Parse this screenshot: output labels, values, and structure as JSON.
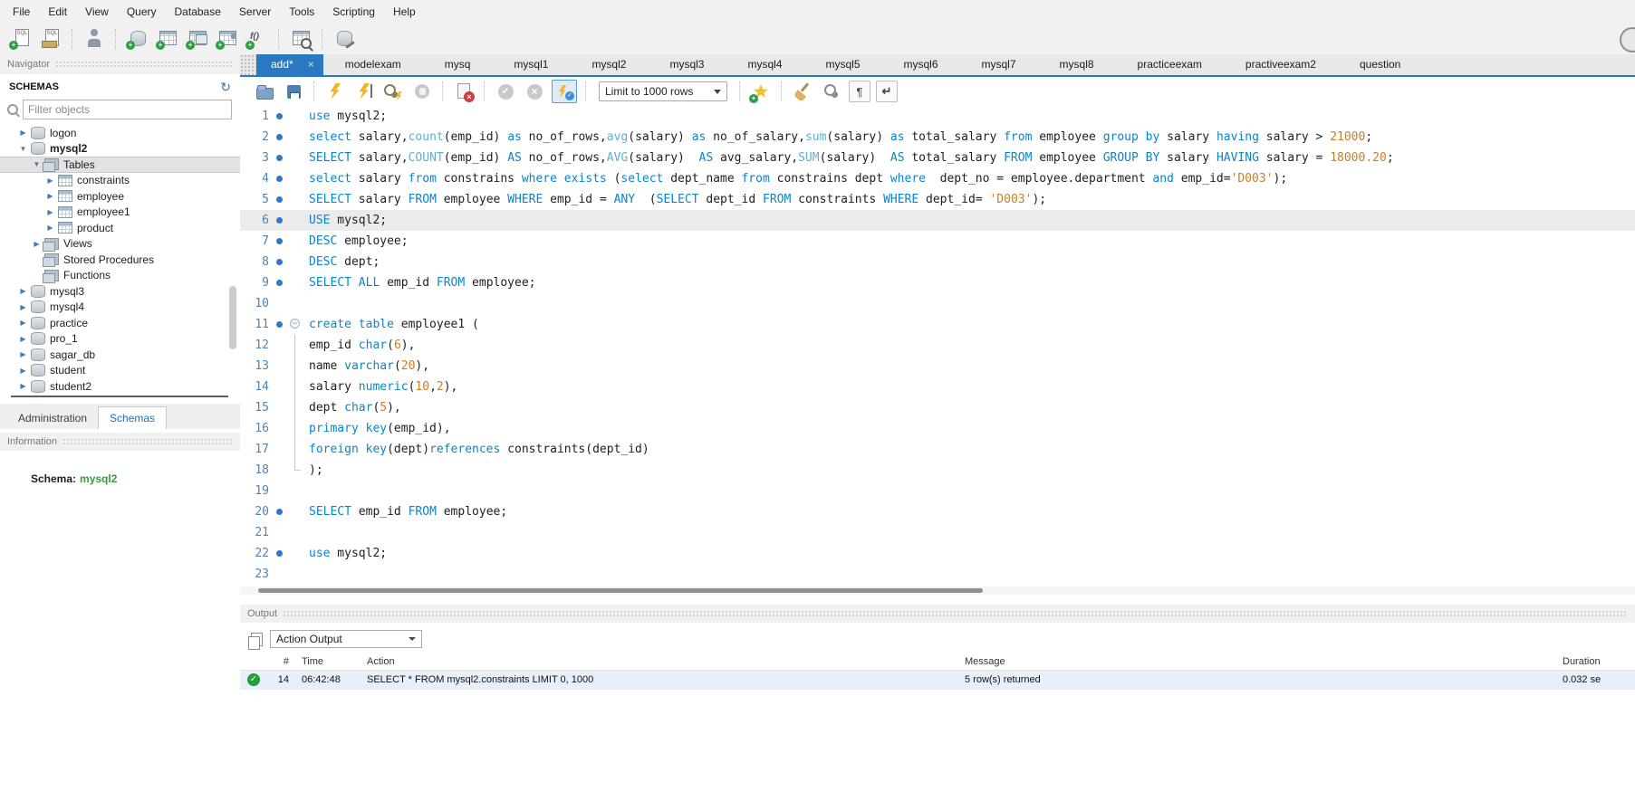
{
  "menubar": {
    "items": [
      "File",
      "Edit",
      "View",
      "Query",
      "Database",
      "Server",
      "Tools",
      "Scripting",
      "Help"
    ]
  },
  "main_toolbar": {
    "icons": [
      "new-sql-tab",
      "open-sql-script",
      "sep",
      "inspector",
      "sep",
      "create-schema",
      "create-table",
      "create-view",
      "create-procedure",
      "create-function",
      "sep",
      "search-table-data",
      "sep",
      "reconnect-dbms"
    ]
  },
  "editor_tabs": {
    "items": [
      {
        "label": "add*",
        "active": true
      },
      {
        "label": "modelexam"
      },
      {
        "label": "mysq"
      },
      {
        "label": "mysql1"
      },
      {
        "label": "mysql2"
      },
      {
        "label": "mysql3"
      },
      {
        "label": "mysql4"
      },
      {
        "label": "mysql5"
      },
      {
        "label": "mysql6"
      },
      {
        "label": "mysql7"
      },
      {
        "label": "mysql8"
      },
      {
        "label": "practiceexam"
      },
      {
        "label": "practiveexam2"
      },
      {
        "label": "question"
      }
    ]
  },
  "navigator": {
    "title": "Navigator",
    "schemas_header": "SCHEMAS",
    "filter_placeholder": "Filter objects",
    "tree": [
      {
        "ind": 1,
        "exp": "r",
        "icon": "db",
        "label": "logon"
      },
      {
        "ind": 1,
        "exp": "d",
        "icon": "db",
        "label": "mysql2",
        "bold": true
      },
      {
        "ind": 2,
        "exp": "d",
        "icon": "grp",
        "label": "Tables",
        "selected": true
      },
      {
        "ind": 3,
        "exp": "r",
        "icon": "tbl",
        "label": "constraints"
      },
      {
        "ind": 3,
        "exp": "r",
        "icon": "tbl",
        "label": "employee"
      },
      {
        "ind": 3,
        "exp": "r",
        "icon": "tbl",
        "label": "employee1"
      },
      {
        "ind": 3,
        "exp": "r",
        "icon": "tbl",
        "label": "product"
      },
      {
        "ind": 2,
        "exp": "r",
        "icon": "grp",
        "label": "Views"
      },
      {
        "ind": 2,
        "icon": "grp",
        "label": "Stored Procedures"
      },
      {
        "ind": 2,
        "icon": "grp",
        "label": "Functions"
      },
      {
        "ind": 1,
        "exp": "r",
        "icon": "db",
        "label": "mysql3"
      },
      {
        "ind": 1,
        "exp": "r",
        "icon": "db",
        "label": "mysql4"
      },
      {
        "ind": 1,
        "exp": "r",
        "icon": "db",
        "label": "practice"
      },
      {
        "ind": 1,
        "exp": "r",
        "icon": "db",
        "label": "pro_1"
      },
      {
        "ind": 1,
        "exp": "r",
        "icon": "db",
        "label": "sagar_db"
      },
      {
        "ind": 1,
        "exp": "r",
        "icon": "db",
        "label": "student"
      },
      {
        "ind": 1,
        "exp": "r",
        "icon": "db",
        "label": "student2"
      }
    ],
    "bottom_tabs": [
      {
        "label": "Administration",
        "active": false
      },
      {
        "label": "Schemas",
        "active": true
      }
    ],
    "information_title": "Information",
    "schema_label": "Schema:",
    "schema_value": "mysql2"
  },
  "editor_toolbar": {
    "icons_left": [
      "open-file",
      "save",
      "sep",
      "execute",
      "execute-current",
      "explain",
      "stop",
      "sep",
      "kill-query",
      "sep",
      "commit",
      "rollback",
      "toggle-autocommit",
      "sep"
    ],
    "limit_dropdown": "Limit to 1000 rows",
    "icons_right": [
      "sep",
      "snippet-star",
      "sep",
      "beautify",
      "find",
      "pilcrow",
      "wrap"
    ]
  },
  "editor": {
    "lines": [
      {
        "dot": true,
        "segs": [
          [
            "kw",
            "use"
          ],
          [
            "pl",
            " mysql2;"
          ]
        ]
      },
      {
        "dot": true,
        "segs": [
          [
            "kw",
            "select"
          ],
          [
            "pl",
            " salary,"
          ],
          [
            "fn",
            "count"
          ],
          [
            "pl",
            "(emp_id) "
          ],
          [
            "kw",
            "as"
          ],
          [
            "pl",
            " no_of_rows,"
          ],
          [
            "fn",
            "avg"
          ],
          [
            "pl",
            "(salary) "
          ],
          [
            "kw",
            "as"
          ],
          [
            "pl",
            " no_of_salary,"
          ],
          [
            "fn",
            "sum"
          ],
          [
            "pl",
            "(salary) "
          ],
          [
            "kw",
            "as"
          ],
          [
            "pl",
            " total_salary "
          ],
          [
            "kw",
            "from"
          ],
          [
            "pl",
            " employee "
          ],
          [
            "kw",
            "group by"
          ],
          [
            "pl",
            " salary "
          ],
          [
            "kw",
            "having"
          ],
          [
            "pl",
            " salary > "
          ],
          [
            "num",
            "21000"
          ],
          [
            "pl",
            ";"
          ]
        ]
      },
      {
        "dot": true,
        "segs": [
          [
            "kw",
            "SELECT"
          ],
          [
            "pl",
            " salary,"
          ],
          [
            "fn",
            "COUNT"
          ],
          [
            "pl",
            "(emp_id) "
          ],
          [
            "kw",
            "AS"
          ],
          [
            "pl",
            " no_of_rows,"
          ],
          [
            "fn",
            "AVG"
          ],
          [
            "pl",
            "(salary)  "
          ],
          [
            "kw",
            "AS"
          ],
          [
            "pl",
            " avg_salary,"
          ],
          [
            "fn",
            "SUM"
          ],
          [
            "pl",
            "(salary)  "
          ],
          [
            "kw",
            "AS"
          ],
          [
            "pl",
            " total_salary "
          ],
          [
            "kw",
            "FROM"
          ],
          [
            "pl",
            " employee "
          ],
          [
            "kw",
            "GROUP BY"
          ],
          [
            "pl",
            " salary "
          ],
          [
            "kw",
            "HAVING"
          ],
          [
            "pl",
            " salary = "
          ],
          [
            "num",
            "18000.20"
          ],
          [
            "pl",
            ";"
          ]
        ]
      },
      {
        "dot": true,
        "segs": [
          [
            "kw",
            "select"
          ],
          [
            "pl",
            " salary "
          ],
          [
            "kw",
            "from"
          ],
          [
            "pl",
            " constrains "
          ],
          [
            "kw",
            "where"
          ],
          [
            "pl",
            " "
          ],
          [
            "kw",
            "exists"
          ],
          [
            "pl",
            " ("
          ],
          [
            "kw",
            "select"
          ],
          [
            "pl",
            " dept_name "
          ],
          [
            "kw",
            "from"
          ],
          [
            "pl",
            " constrains dept "
          ],
          [
            "kw",
            "where"
          ],
          [
            "pl",
            "  dept_no = employee.department "
          ],
          [
            "kw",
            "and"
          ],
          [
            "pl",
            " emp_id="
          ],
          [
            "str",
            "'D003'"
          ],
          [
            "pl",
            ");"
          ]
        ]
      },
      {
        "dot": true,
        "segs": [
          [
            "kw",
            "SELECT"
          ],
          [
            "pl",
            " salary "
          ],
          [
            "kw",
            "FROM"
          ],
          [
            "pl",
            " employee "
          ],
          [
            "kw",
            "WHERE"
          ],
          [
            "pl",
            " emp_id = "
          ],
          [
            "kw",
            "ANY"
          ],
          [
            "pl",
            "  ("
          ],
          [
            "kw",
            "SELECT"
          ],
          [
            "pl",
            " dept_id "
          ],
          [
            "kw",
            "FROM"
          ],
          [
            "pl",
            " constraints "
          ],
          [
            "kw",
            "WHERE"
          ],
          [
            "pl",
            " dept_id= "
          ],
          [
            "str",
            "'D003'"
          ],
          [
            "pl",
            ");"
          ]
        ]
      },
      {
        "dot": true,
        "hl": true,
        "segs": [
          [
            "kw",
            "USE"
          ],
          [
            "pl",
            " mysql2;"
          ]
        ]
      },
      {
        "dot": true,
        "segs": [
          [
            "kw",
            "DESC"
          ],
          [
            "pl",
            " employee;"
          ]
        ]
      },
      {
        "dot": true,
        "segs": [
          [
            "kw",
            "DESC"
          ],
          [
            "pl",
            " dept;"
          ]
        ]
      },
      {
        "dot": true,
        "segs": [
          [
            "kw",
            "SELECT"
          ],
          [
            "pl",
            " "
          ],
          [
            "kw",
            "ALL"
          ],
          [
            "pl",
            " emp_id "
          ],
          [
            "kw",
            "FROM"
          ],
          [
            "pl",
            " employee;"
          ]
        ]
      },
      {
        "segs": []
      },
      {
        "dot": true,
        "fold": "open",
        "segs": [
          [
            "kw",
            "create table"
          ],
          [
            "pl",
            " employee1 ("
          ]
        ]
      },
      {
        "fold": "line",
        "segs": [
          [
            "pl",
            "emp_id "
          ],
          [
            "kw",
            "char"
          ],
          [
            "pl",
            "("
          ],
          [
            "num",
            "6"
          ],
          [
            "pl",
            "),"
          ]
        ]
      },
      {
        "fold": "line",
        "segs": [
          [
            "pl",
            "name "
          ],
          [
            "kw",
            "varchar"
          ],
          [
            "pl",
            "("
          ],
          [
            "num",
            "20"
          ],
          [
            "pl",
            "),"
          ]
        ]
      },
      {
        "fold": "line",
        "segs": [
          [
            "pl",
            "salary "
          ],
          [
            "kw",
            "numeric"
          ],
          [
            "pl",
            "("
          ],
          [
            "num",
            "10"
          ],
          [
            "pl",
            ","
          ],
          [
            "num",
            "2"
          ],
          [
            "pl",
            "),"
          ]
        ]
      },
      {
        "fold": "line",
        "segs": [
          [
            "pl",
            "dept "
          ],
          [
            "kw",
            "char"
          ],
          [
            "pl",
            "("
          ],
          [
            "num",
            "5"
          ],
          [
            "pl",
            "),"
          ]
        ]
      },
      {
        "fold": "line",
        "segs": [
          [
            "kw",
            "primary key"
          ],
          [
            "pl",
            "(emp_id),"
          ]
        ]
      },
      {
        "fold": "line",
        "segs": [
          [
            "kw",
            "foreign key"
          ],
          [
            "pl",
            "(dept)"
          ],
          [
            "kw",
            "references"
          ],
          [
            "pl",
            " constraints(dept_id)"
          ]
        ]
      },
      {
        "fold": "end",
        "segs": [
          [
            "pl",
            ");"
          ]
        ]
      },
      {
        "segs": []
      },
      {
        "dot": true,
        "segs": [
          [
            "kw",
            "SELECT"
          ],
          [
            "pl",
            " emp_id "
          ],
          [
            "kw",
            "FROM"
          ],
          [
            "pl",
            " employee;"
          ]
        ]
      },
      {
        "segs": []
      },
      {
        "dot": true,
        "segs": [
          [
            "kw",
            "use"
          ],
          [
            "pl",
            " mysql2;"
          ]
        ]
      },
      {
        "segs": []
      }
    ]
  },
  "output": {
    "title": "Output",
    "view_selector": "Action Output",
    "columns": [
      "#",
      "Time",
      "Action",
      "Message",
      "Duration"
    ],
    "rows": [
      {
        "status": "success",
        "num": "14",
        "time": "06:42:48",
        "action": "SELECT * FROM mysql2.constraints LIMIT 0, 1000",
        "message": "5 row(s) returned",
        "duration": "0.032 se"
      }
    ]
  },
  "colors": {
    "accent_blue": "#2a78c2",
    "keyword_blue": "#0a85c8",
    "function_cyan": "#62aed2",
    "literal_orange": "#c87e29",
    "schema_green": "#2e9e3e",
    "success_green": "#23a036"
  }
}
